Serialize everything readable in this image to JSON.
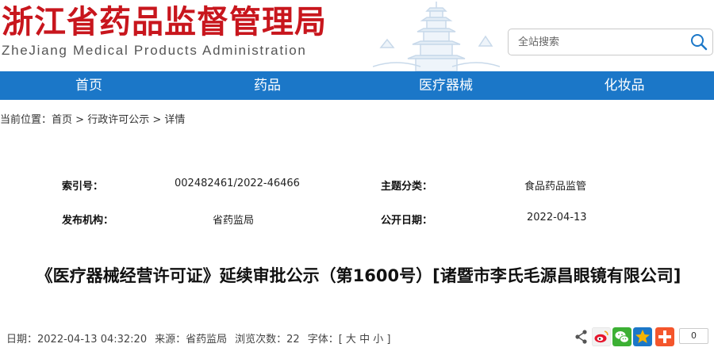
{
  "header": {
    "title": "浙江省药品监督管理局",
    "subtitle": "ZheJiang Medical Products Administration",
    "search_placeholder": "全站搜索"
  },
  "nav": {
    "items": [
      "首页",
      "药品",
      "医疗器械",
      "化妆品"
    ]
  },
  "breadcrumb": {
    "prefix": "当前位置：",
    "items": [
      "首页",
      "行政许可公示",
      "详情"
    ],
    "separator": ">"
  },
  "meta": {
    "index_label": "索引号：",
    "index_value": "002482461/2022-46466",
    "category_label": "主题分类：",
    "category_value": "食品药品监管",
    "issuer_label": "发布机构：",
    "issuer_value": "省药监局",
    "date_label": "公开日期：",
    "date_value": "2022-04-13"
  },
  "article": {
    "title": "《医疗器械经营许可证》延续审批公示（第1600号）[诸暨市李氏毛源昌眼镜有限公司]"
  },
  "info": {
    "date_label": "日期：",
    "date_value": "2022-04-13 04:32:20",
    "source_label": "来源：",
    "source_value": "省药监局",
    "views_label": "浏览次数：",
    "views_value": "22",
    "font_label": "字体：",
    "font_open": "[",
    "font_large": "大",
    "font_medium": "中",
    "font_small": "小",
    "font_close": "]"
  },
  "share": {
    "count": "0",
    "colors": {
      "weibo": "#e6162d",
      "wechat": "#3cb034",
      "qzone": "#f5b400",
      "more": "#f4562c"
    }
  },
  "colors": {
    "brand_red": "#c8161d",
    "nav_blue": "#1b77c8"
  }
}
